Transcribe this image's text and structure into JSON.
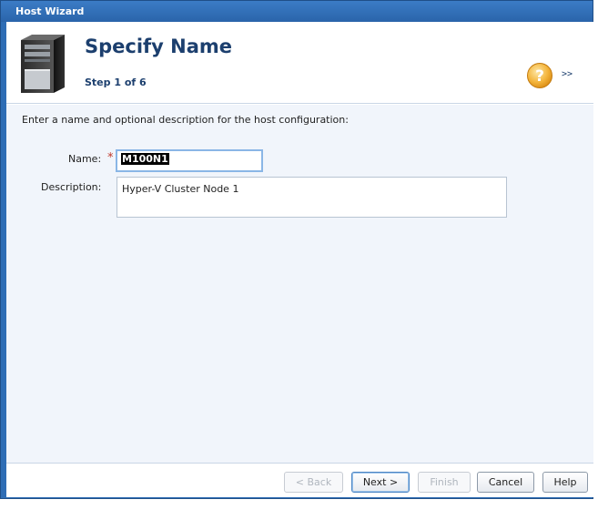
{
  "window": {
    "title": "Host Wizard"
  },
  "header": {
    "title": "Specify Name",
    "step": "Step 1 of 6",
    "more_label": ">>",
    "icons": {
      "server": "server-tower-icon",
      "help": "help-icon"
    },
    "help_color": "#f0a92a"
  },
  "content": {
    "instructions": "Enter a name and optional description for the host configuration:",
    "name": {
      "label": "Name:",
      "required_mark": "*",
      "value": "M100N1"
    },
    "description": {
      "label": "Description:",
      "value": "Hyper-V Cluster Node 1"
    }
  },
  "footer": {
    "back_label": "< Back",
    "next_label": "Next >",
    "finish_label": "Finish",
    "cancel_label": "Cancel",
    "help_label": "Help"
  },
  "colors": {
    "titlebar": "#2e6db5",
    "heading": "#1c3f6e",
    "content_bg": "#f1f5fb"
  }
}
